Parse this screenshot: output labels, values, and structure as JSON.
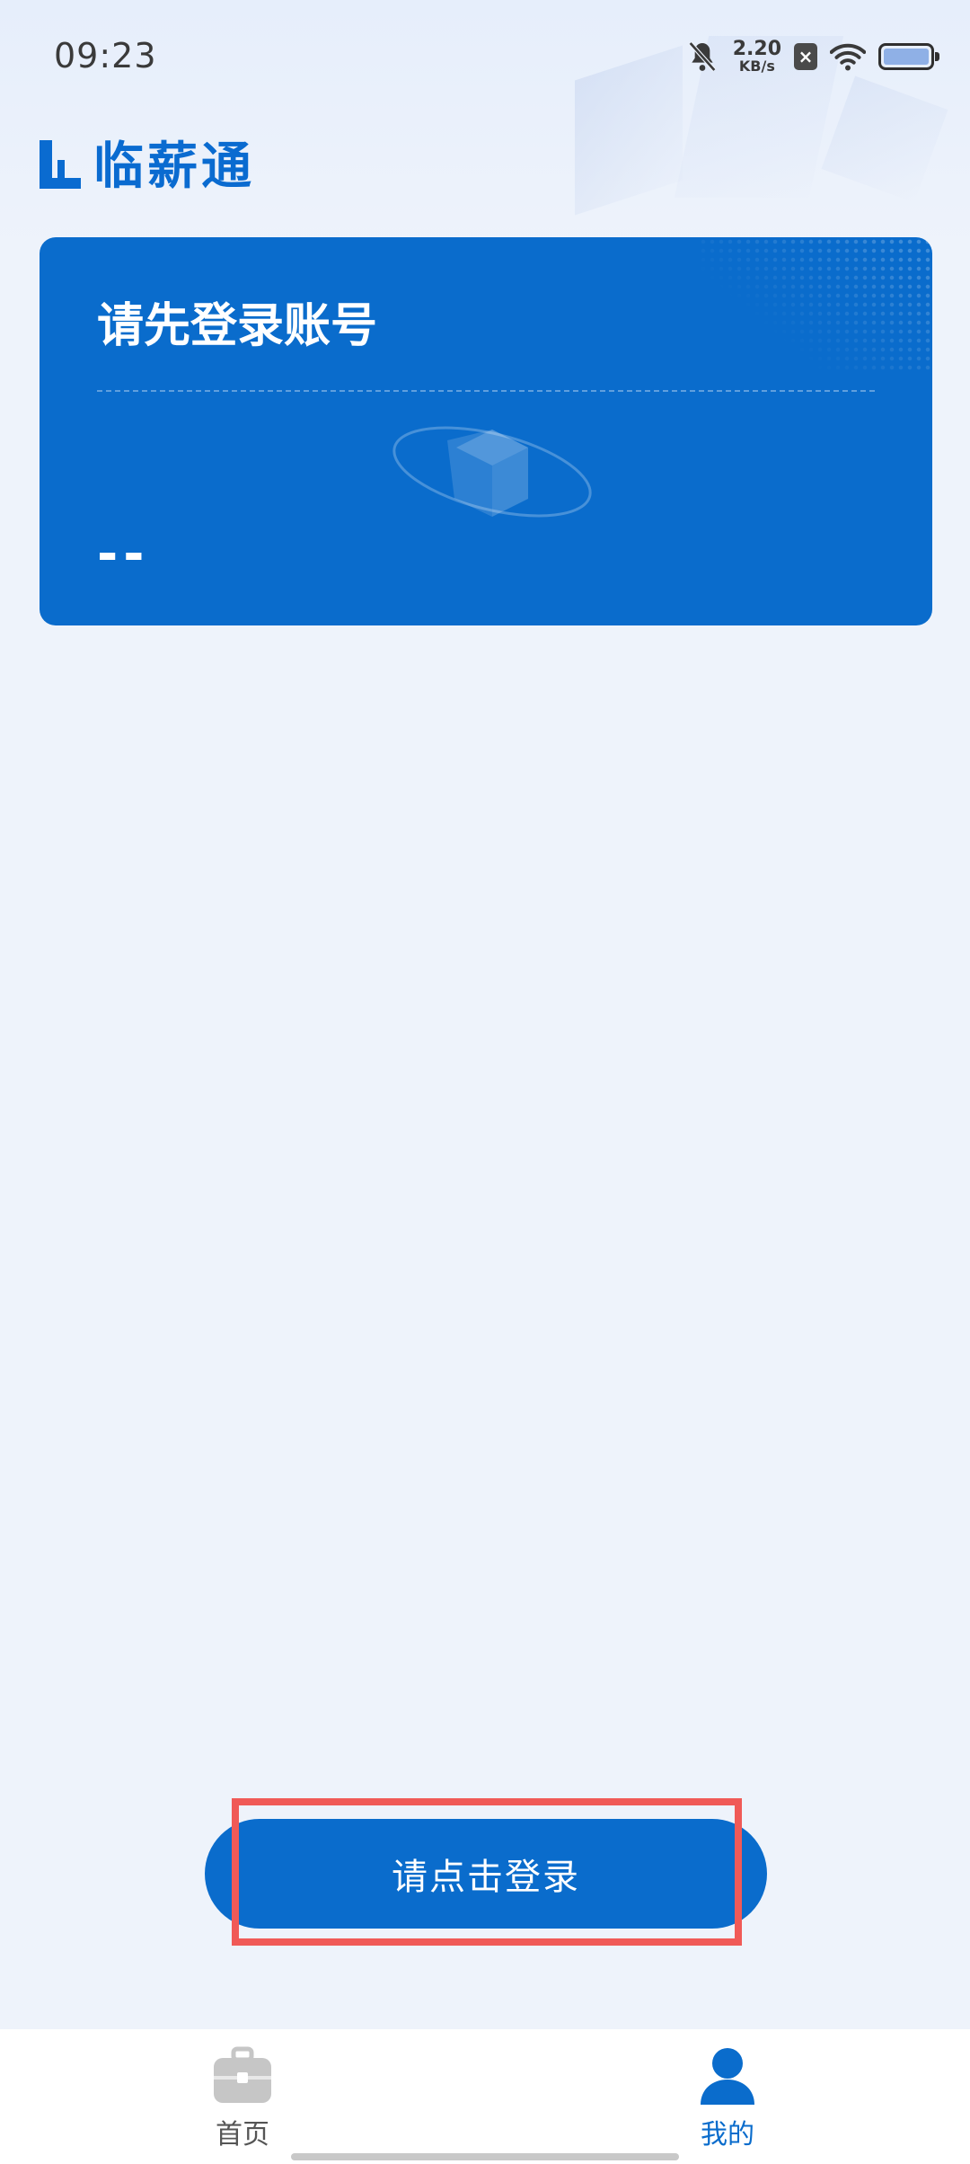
{
  "status_bar": {
    "time": "09:23",
    "net_speed_value": "2.20",
    "net_speed_unit": "KB/s",
    "sim_badge": "×",
    "icons": [
      "bell-muted-icon",
      "sim-x-icon",
      "wifi-icon",
      "battery-icon"
    ],
    "battery_level": 1.0
  },
  "app": {
    "logo_text": "临薪通",
    "accent_color": "#0a6ccc"
  },
  "account_card": {
    "title": "请先登录账号",
    "value": "--"
  },
  "login_button": {
    "label": "请点击登录"
  },
  "bottom_nav": {
    "items": [
      {
        "label": "首页",
        "icon": "briefcase-icon",
        "active": false
      },
      {
        "label": "我的",
        "icon": "user-icon",
        "active": true
      }
    ]
  }
}
